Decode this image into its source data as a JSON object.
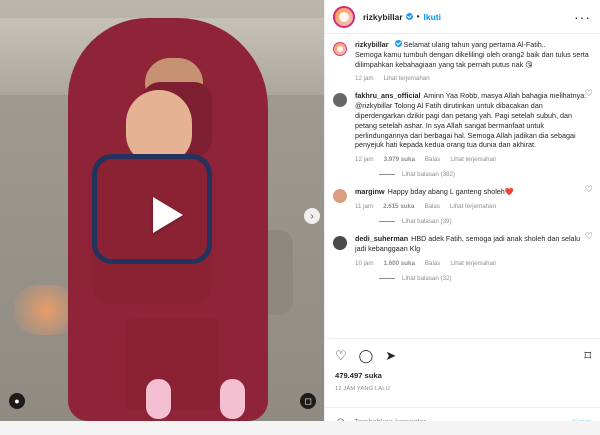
{
  "header": {
    "username": "rizkybillar",
    "dot": "•",
    "follow": "Ikuti"
  },
  "caption": {
    "username": "rizkybillar",
    "text": "Selamat ulang tahun yang pertama Al-Fatih..\nSemoga kamu tumbuh dengan dikelilingi oleh orang2 baik dan tulus serta dilimpahkan kebahagiaan yang tak pernah putus nak 😘",
    "time": "12 jam",
    "translate": "Lihat terjemahan"
  },
  "comments": [
    {
      "username": "fakhru_ans_official",
      "text": "Aminn Yaa Robb, masya Allah bahagia melihatnya. @rizkybillar Tolong Al Fatih dirutinkan untuk dibacakan dan diperdengarkan dzikir pagi dan petang yah. Pagi setelah subuh, dan petang setelah ashar. In sya Allah sangat bermanfaat untuk perlindungannya dari berbagai hal. Semoga Allah jadikan dia sebagai penyejuk hati kepada kedua orang tua dunia dan akhirat.",
      "time": "12 jam",
      "likes": "3.979 suka",
      "reply": "Balas",
      "translate": "Lihat terjemahan",
      "replies": "Lihat balasan (382)"
    },
    {
      "username": "marginw",
      "text": "Happy bday abang L ganteng sholeh❤️",
      "time": "11 jam",
      "likes": "2.615 suka",
      "reply": "Balas",
      "translate": "Lihat terjemahan",
      "replies": "Lihat balasan (39)"
    },
    {
      "username": "dedi_suherman",
      "text": "HBD adek Fatih, semoga jadi anak sholeh dan selalu jadi kebanggaan Klg",
      "time": "10 jam",
      "likes": "1.600 suka",
      "reply": "Balas",
      "translate": "Lihat terjemahan",
      "replies": "Lihat balasan (32)"
    }
  ],
  "actions": {
    "likes": "479.497 suka",
    "time": "12 JAM YANG LALU",
    "comment_placeholder": "Tambahkan komentar...",
    "post": "Kirim"
  },
  "icons": {
    "play": "play-icon",
    "next": "chevron-right-icon",
    "user": "user-icon",
    "sound": "sound-off-icon",
    "more": "more-icon",
    "heart": "heart-icon",
    "comment": "comment-icon",
    "share": "share-icon",
    "save": "bookmark-icon",
    "emoji": "emoji-icon"
  }
}
